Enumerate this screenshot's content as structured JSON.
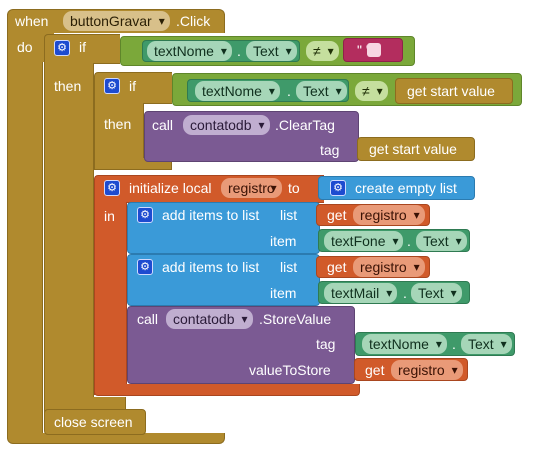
{
  "event": {
    "when_label": "when",
    "component": "buttonGravar",
    "event_name": ".Click",
    "do_label": "do"
  },
  "if_outer": {
    "if_label": "if",
    "then_label": "then",
    "condition": {
      "component": "textNome",
      "dot": ".",
      "property": "Text",
      "operator": "≠",
      "string_value": "\" \""
    }
  },
  "if_inner": {
    "if_label": "if",
    "then_label": "then",
    "condition": {
      "component": "textNome",
      "dot": ".",
      "property": "Text",
      "operator": "≠",
      "value_label": "get start value"
    },
    "call": {
      "call_label": "call",
      "component": "contatodb",
      "method": ".ClearTag",
      "param_label": "tag",
      "param_value": "get start value"
    }
  },
  "local": {
    "init_label": "initialize local",
    "var_name": "registro",
    "to_label": "to",
    "in_label": "in",
    "create_list_label": "create empty list"
  },
  "add_items_1": {
    "label": "add items to list",
    "list_label": "list",
    "item_label": "item",
    "get_label": "get",
    "get_var": "registro",
    "item_component": "textFone",
    "dot": ".",
    "item_property": "Text"
  },
  "add_items_2": {
    "label": "add items to list",
    "list_label": "list",
    "item_label": "item",
    "get_label": "get",
    "get_var": "registro",
    "item_component": "textMail",
    "dot": ".",
    "item_property": "Text"
  },
  "store": {
    "call_label": "call",
    "component": "contatodb",
    "method": ".StoreValue",
    "tag_label": "tag",
    "tag_component": "textNome",
    "dot": ".",
    "tag_property": "Text",
    "value_label": "valueToStore",
    "get_label": "get",
    "get_var": "registro"
  },
  "close": {
    "label": "close screen"
  },
  "colors": {
    "control": "#b08a2e",
    "procedure": "#7b5a93",
    "local_variable": "#d15a2a",
    "list": "#3a9ad8",
    "text": "#3f9a6a",
    "logic": "#7ba83a",
    "string": "#b32d5e"
  }
}
